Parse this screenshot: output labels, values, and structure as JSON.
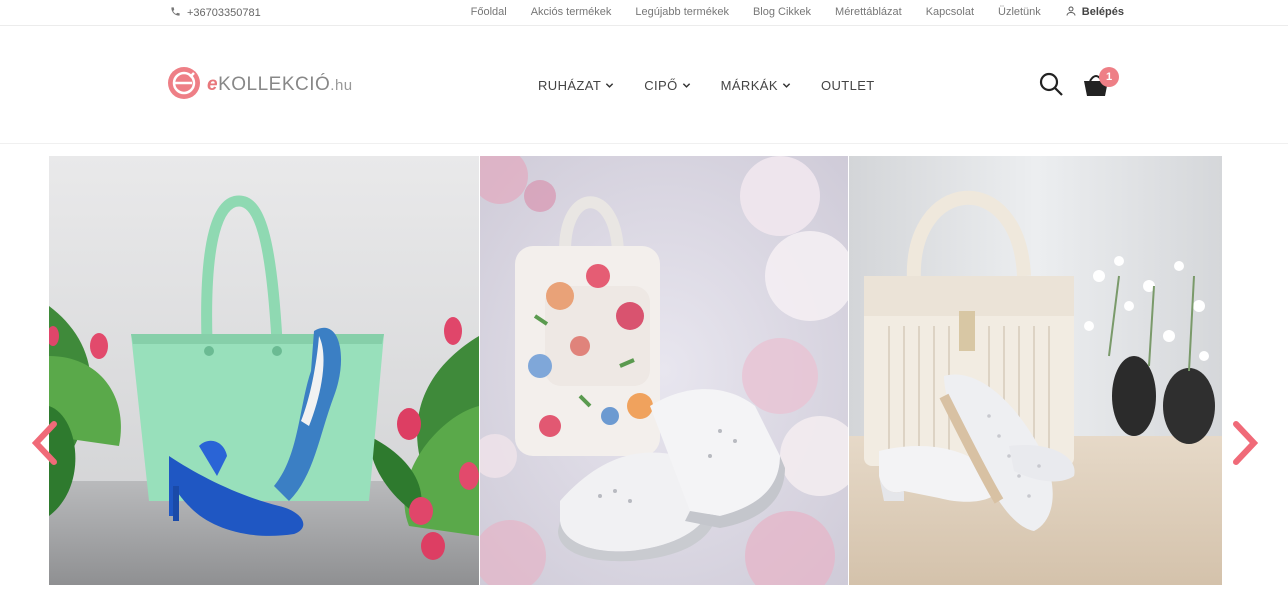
{
  "topbar": {
    "phone": "+36703350781",
    "links": [
      "Főoldal",
      "Akciós termékek",
      "Legújabb termékek",
      "Blog Cikkek",
      "Mérettáblázat",
      "Kapcsolat",
      "Üzletünk"
    ],
    "login_label": "Belépés"
  },
  "logo": {
    "text_e": "e",
    "text_main": "KOLLEKCIÓ",
    "text_tld": ".hu"
  },
  "nav": {
    "items": [
      "RUHÁZAT",
      "CIPŐ",
      "MÁRKÁK",
      "OUTLET"
    ]
  },
  "cart": {
    "count": "1"
  },
  "slider": {
    "slides": [
      "mint-green-tote-and-blue-heels",
      "floral-backpack-and-white-sneakers",
      "cream-handbag-and-white-flats"
    ]
  },
  "colors": {
    "accent": "#ee7f86",
    "arrow": "#f06a78",
    "text": "#444444"
  },
  "icons": {
    "phone": "phone-icon",
    "user": "user-icon",
    "search": "search-icon",
    "cart": "cart-icon",
    "chevron": "chevron-down-icon",
    "prev": "chevron-left-icon",
    "next": "chevron-right-icon"
  }
}
